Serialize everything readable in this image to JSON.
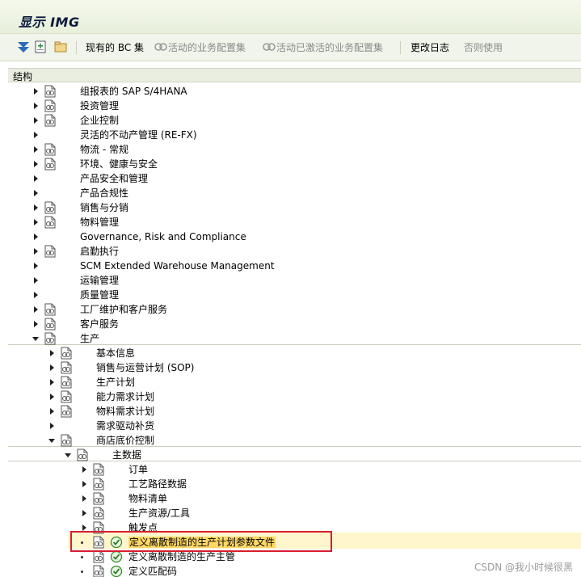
{
  "window": {
    "title": "显示 IMG"
  },
  "toolbar": {
    "existing_bc_sets": "现有的 BC 集",
    "active_bc_sets": "活动的业务配置集",
    "activated_bc_sets": "活动已激活的业务配置集",
    "change_log": "更改日志",
    "no_use": "否则使用"
  },
  "structure": {
    "header": "结构",
    "level0": [
      "组报表的 SAP S/4HANA",
      "投资管理",
      "企业控制",
      "灵活的不动产管理 (RE-FX)",
      "物流 - 常规",
      "环境、健康与安全",
      "产品安全和管理",
      "产品合规性",
      "销售与分销",
      "物料管理",
      "Governance, Risk and Compliance",
      "启勤执行",
      "SCM Extended Warehouse Management",
      "运输管理",
      "质量管理",
      "工厂维护和客户服务",
      "客户服务",
      "生产"
    ],
    "level1": [
      "基本信息",
      "销售与运营计划 (SOP)",
      "生产计划",
      "能力需求计划",
      "物料需求计划",
      "需求驱动补货",
      "商店底价控制"
    ],
    "level2": [
      "主数据"
    ],
    "level3": [
      "订单",
      "工艺路径数据",
      "物料清单",
      "生产资源/工具",
      "触发点"
    ],
    "activities": [
      "定义离散制造的生产计划参数文件",
      "定义离散制造的生产主管",
      "定义匹配码"
    ]
  },
  "watermark": "CSDN @我小时候很黑"
}
